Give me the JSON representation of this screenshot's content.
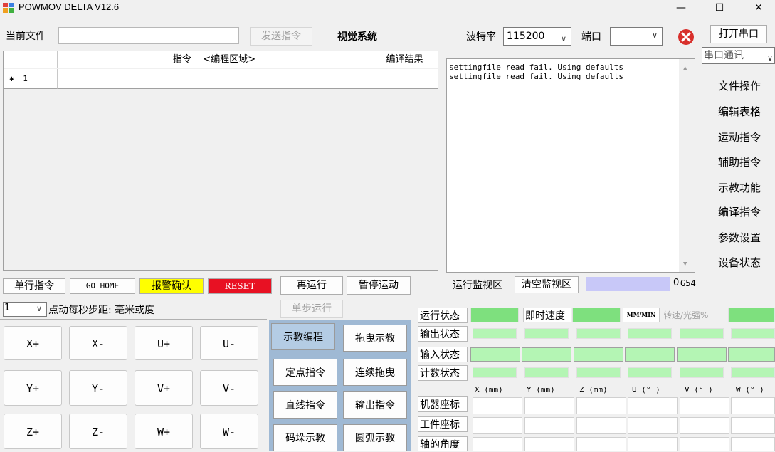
{
  "window": {
    "title": "POWMOV   DELTA  V12.6",
    "min_label": "—",
    "max_label": "☐",
    "close_label": "✕"
  },
  "toolbar": {
    "current_file_label": "当前文件",
    "current_file_value": "",
    "send_button": "发送指令",
    "vision_label": "视觉系统",
    "baud_label": "波特率",
    "baud_value": "115200",
    "port_label": "端口",
    "port_value": "",
    "open_port_button": "打开串口",
    "serial_comm_value": "串口通讯"
  },
  "grid": {
    "col_cmd": "指令    <编程区域>",
    "col_result": "编译结果",
    "rows": [
      {
        "marker": "✱",
        "num": "1"
      }
    ]
  },
  "log": {
    "lines": [
      "settingfile read fail. Using defaults",
      "settingfile read fail. Using defaults"
    ]
  },
  "side_menu": [
    "文件操作",
    "编辑表格",
    "运动指令",
    "辅助指令",
    "示教功能",
    "编译指令",
    "参数设置",
    "设备状态"
  ],
  "actions": {
    "single_cmd": "单行指令",
    "go_home": "GO HOME",
    "alarm_ack": "报警确认",
    "reset": "RESET",
    "rerun": "再运行",
    "pause": "暂停运动",
    "step_run": "单步运行",
    "monitor_label": "运行监视区",
    "clear_monitor": "清空监视区",
    "monitor_value": "0",
    "g54": "G54"
  },
  "jog": {
    "step_value": "1",
    "step_label": "点动每秒步距: 毫米或度",
    "buttons": [
      [
        "X+",
        "X-",
        "U+",
        "U-"
      ],
      [
        "Y+",
        "Y-",
        "V+",
        "V-"
      ],
      [
        "Z+",
        "Z-",
        "W+",
        "W-"
      ]
    ]
  },
  "teach": [
    [
      "示教编程",
      "拖曳示教"
    ],
    [
      "定点指令",
      "连续拖曳"
    ],
    [
      "直线指令",
      "输出指令"
    ],
    [
      "码垛示教",
      "圆弧示教"
    ]
  ],
  "status": {
    "run_state": "运行状态",
    "output_state": "输出状态",
    "input_state": "输入状态",
    "count_state": "计数状态",
    "instant_speed": "即时速度",
    "speed_unit": "MM/MIN",
    "spindle_label": "转速/光强%",
    "axes": [
      "X (mm)",
      "Y (mm)",
      "Z (mm)",
      "U (° )",
      "V (° )",
      "W (° )"
    ],
    "machine_coord": "机器座标",
    "work_coord": "工件座标",
    "axis_angle": "轴的角度"
  },
  "colors": {
    "green": "#b4f5b4",
    "reset_red": "#e81123",
    "alarm_yellow": "#ffff00",
    "monitor_blue": "#c8c8f8",
    "teach_panel": "#9fb9d4"
  }
}
